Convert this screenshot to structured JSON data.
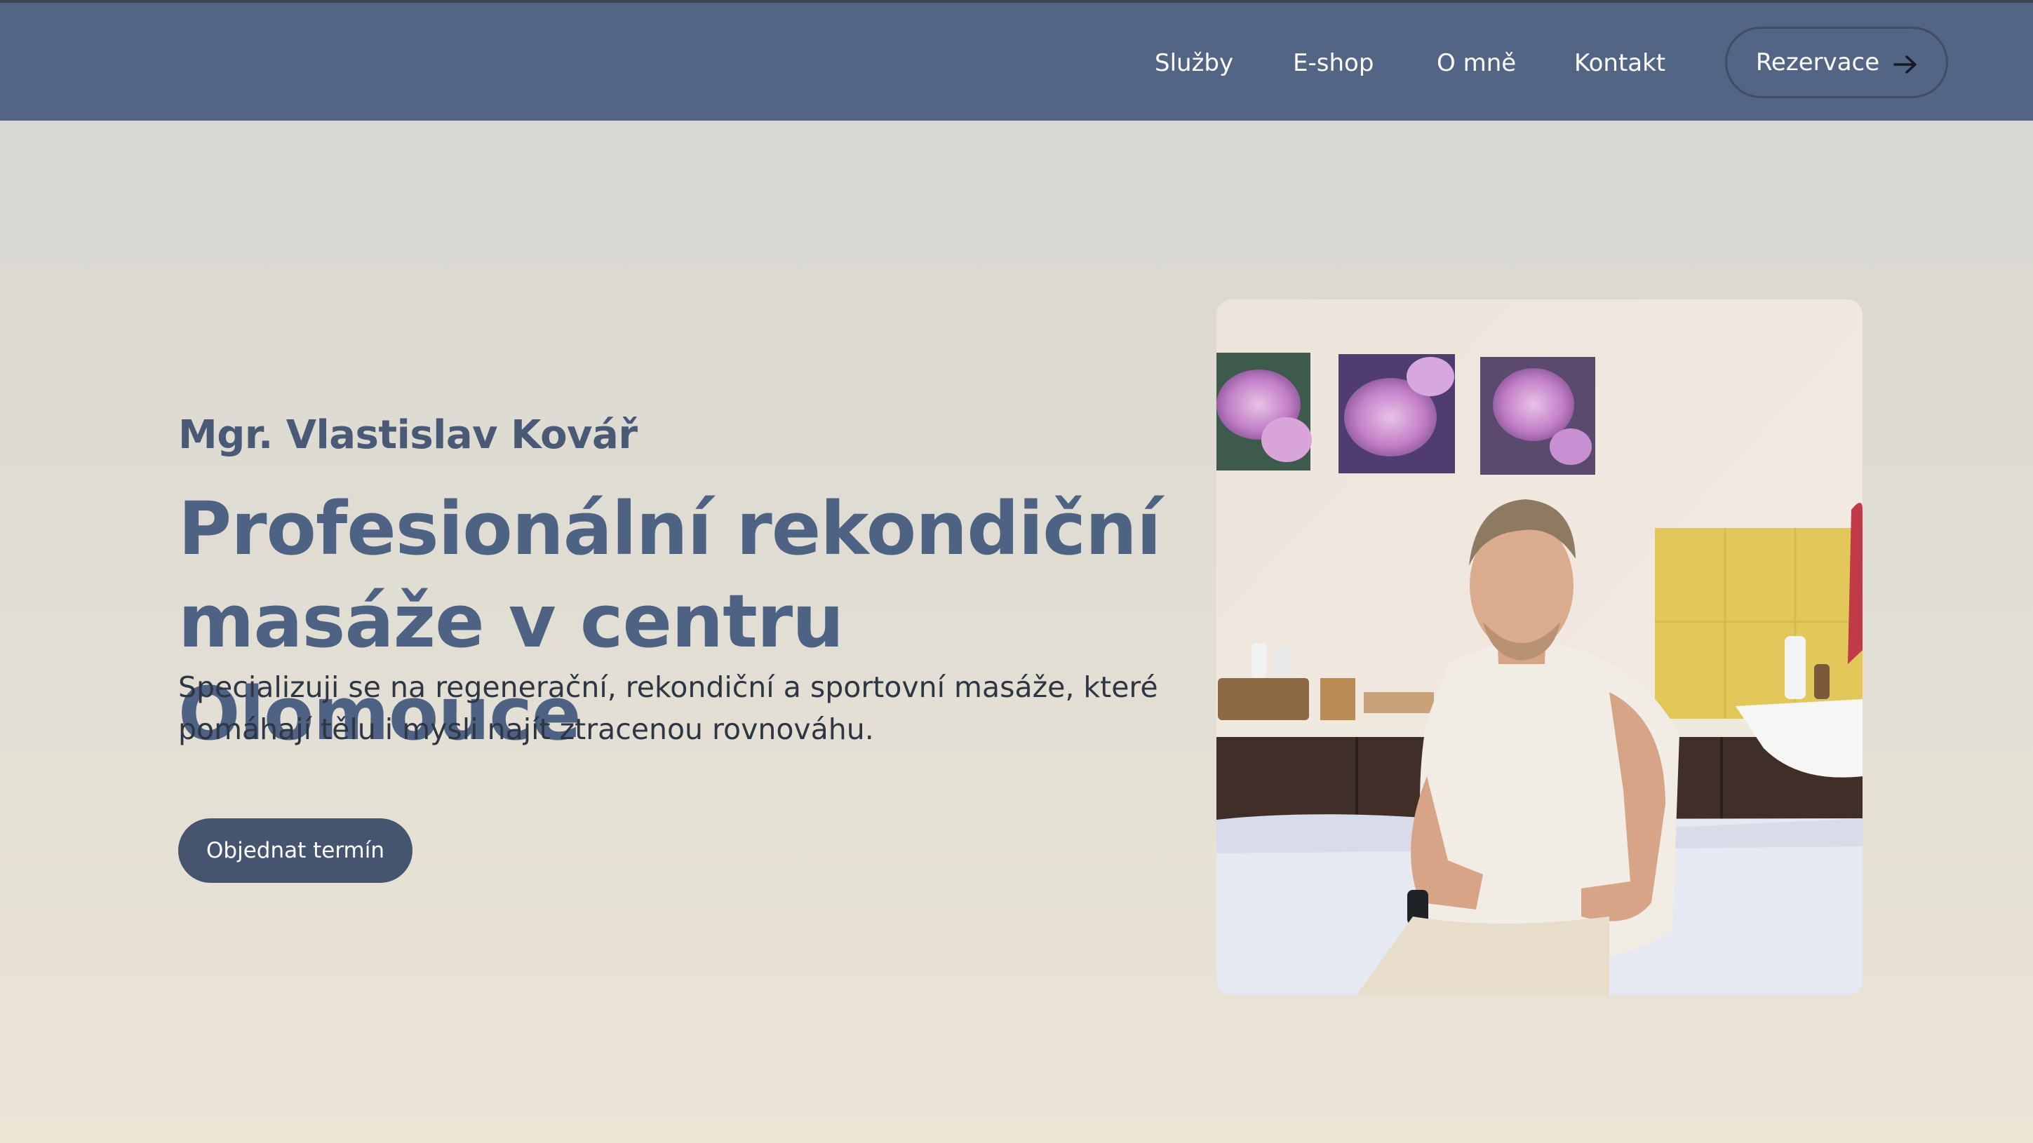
{
  "nav": {
    "links": [
      "Služby",
      "E-shop",
      "O mně",
      "Kontakt"
    ],
    "cta_label": "Rezervace"
  },
  "hero": {
    "name": "Mgr. Vlastislav Kovář",
    "title": "Profesionální rekondiční masáže v centru Olomouce",
    "description": "Specializuji se na regenerační, rekondiční a sportovní masáže, které pomáhají tělu i mysli najít ztracenou rovnováhu.",
    "order_button": "Objednat termín"
  },
  "colors": {
    "navbar": "#526584",
    "title": "#4e6283",
    "button": "#45546f"
  },
  "icons": {
    "cta": "arrow-right-icon"
  }
}
